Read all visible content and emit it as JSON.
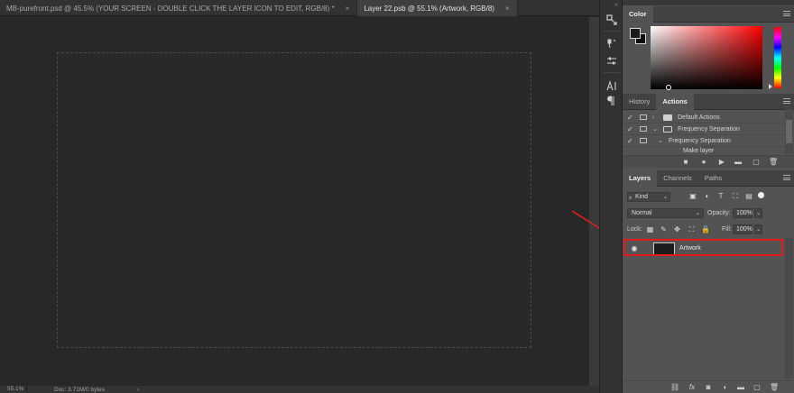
{
  "tabs": [
    {
      "label": "MB-purefront.psd @ 45.5% (YOUR SCREEN - DOUBLE CLICK THE LAYER ICON TO EDIT, RGB/8) *",
      "close": "×",
      "active": false
    },
    {
      "label": "Layer 22.psb @ 55.1% (Artwork, RGB/8)",
      "close": "×",
      "active": true
    }
  ],
  "status": {
    "zoom": "55.1%",
    "doc": "Doc: 3.71M/0 bytes",
    "arrow": "›"
  },
  "toolcol": {
    "collapse": "«"
  },
  "color_panel": {
    "tab": "Color",
    "foreground": "#1b1b1b",
    "background": "#0d0d0d"
  },
  "actions_panel": {
    "tabs": {
      "history": "History",
      "actions": "Actions"
    },
    "rows": [
      {
        "label": "Default Actions",
        "expand": "›",
        "open": false
      },
      {
        "label": "Frequency Separation",
        "expand": "⌄",
        "open": true
      },
      {
        "label": "Frequency Separation",
        "expand": "⌄",
        "open": false
      },
      {
        "label": "Make layer",
        "expand": "",
        "open": false
      }
    ]
  },
  "layers_panel": {
    "tabs": {
      "layers": "Layers",
      "channels": "Channels",
      "paths": "Paths"
    },
    "kind": "Kind",
    "blend_mode": "Normal",
    "opacity_label": "Opacity:",
    "opacity": "100%",
    "lock_label": "Lock:",
    "fill_label": "Fill:",
    "fill": "100%",
    "layer": {
      "name": "Artwork"
    }
  },
  "colors": {
    "highlight": "#e01c1c",
    "panel": "#535353",
    "canvas": "#282828"
  }
}
